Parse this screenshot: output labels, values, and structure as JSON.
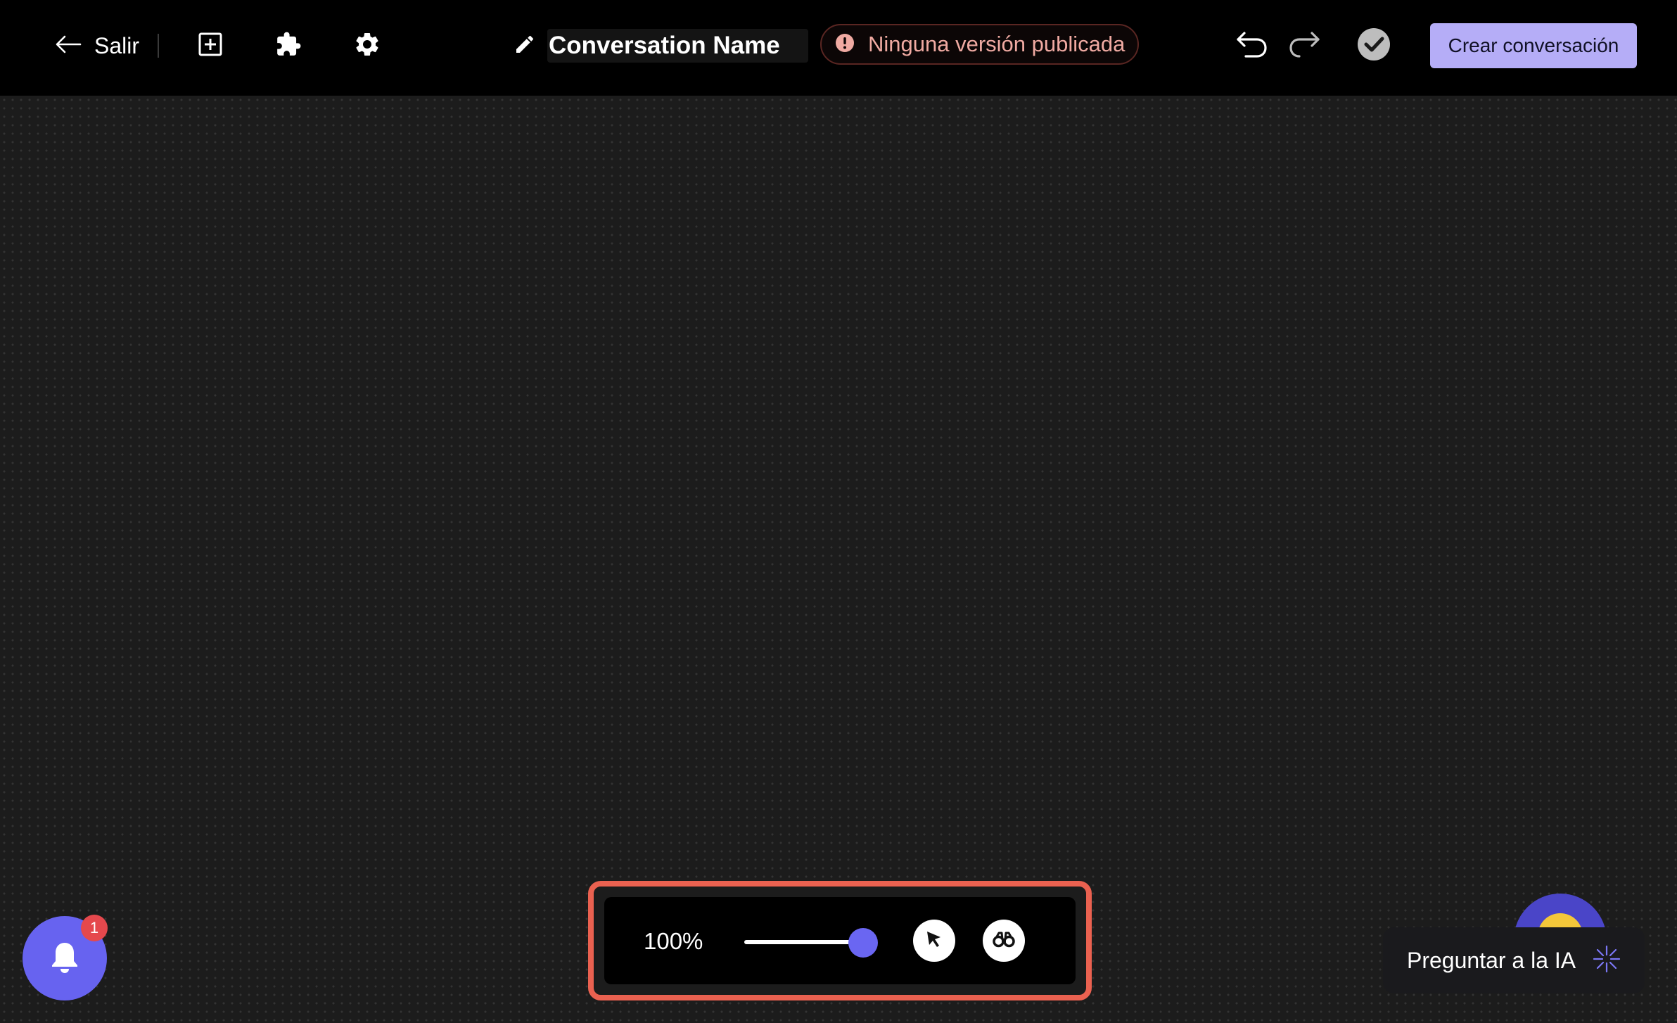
{
  "header": {
    "exit_label": "Salir",
    "conversation_title": "Conversation Name",
    "status_text": "Ninguna versión publicada",
    "create_button_label": "Crear conversación",
    "icons": [
      "arrow-left-icon",
      "add-box-icon",
      "puzzle-icon",
      "gear-icon",
      "pencil-icon",
      "alert-icon",
      "undo-icon",
      "redo-icon",
      "check-circle-icon"
    ]
  },
  "zoom_toolbar": {
    "zoom_label": "100%",
    "zoom_level": 1.0,
    "tools": [
      "cursor-icon",
      "binoculars-icon"
    ]
  },
  "notifications": {
    "count": "1"
  },
  "assistant": {
    "label": "Preguntar a la IA",
    "icon": "sparkle-icon"
  },
  "colors": {
    "accent": "#6a66f2",
    "create_button": "#b5adf7",
    "status_text": "#f0aaa2",
    "highlight_border": "#ea6150",
    "badge": "#e5484d"
  }
}
